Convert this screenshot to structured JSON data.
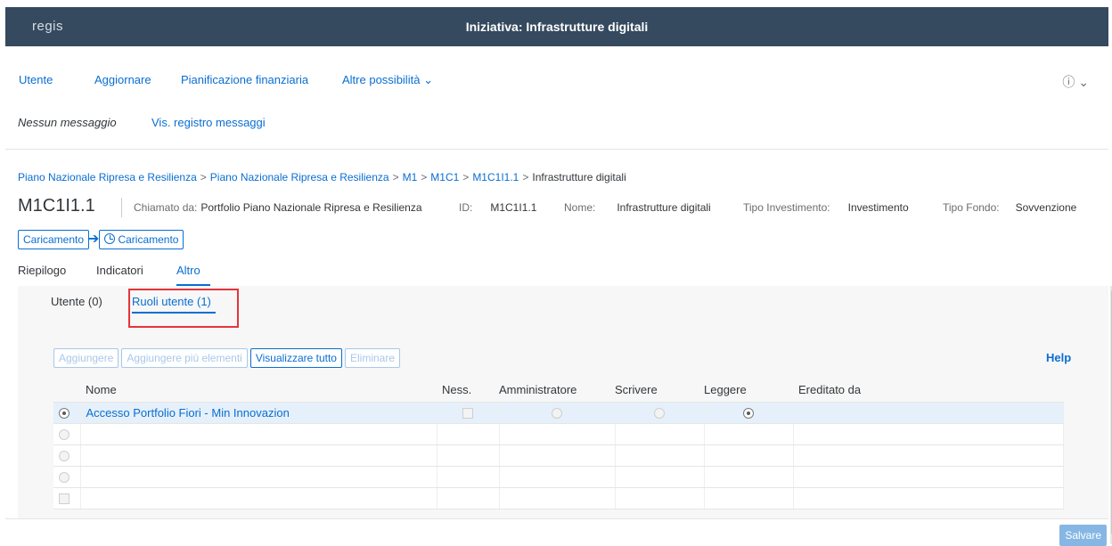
{
  "header": {
    "logo": "regis",
    "title": "Iniziativa: Infrastrutture digitali"
  },
  "menu": {
    "items": [
      "Utente",
      "Aggiornare",
      "Pianificazione finanziaria",
      "Altre possibilità"
    ],
    "more_chevron": "chevron-down-icon",
    "help_icon": "question-circle-icon"
  },
  "messages": {
    "none": "Nessun messaggio",
    "log": "Vis. registro messaggi"
  },
  "breadcrumb": {
    "links": [
      "Piano Nazionale Ripresa e Resilienza",
      "Piano Nazionale Ripresa e Resilienza",
      "M1",
      "M1C1",
      "M1C1I1.1"
    ],
    "separator": ">",
    "current": "Infrastrutture digitali"
  },
  "object": {
    "title": "M1C1I1.1",
    "attributes": [
      {
        "label": "Chiamato da:",
        "value": "Portfolio Piano Nazionale Ripresa e Resilienza"
      },
      {
        "label": "ID:",
        "value": "M1C1I1.1"
      },
      {
        "label": "Nome:",
        "value": "Infrastrutture digitali"
      },
      {
        "label": "Tipo Investimento:",
        "value": "Investimento"
      },
      {
        "label": "Tipo Fondo:",
        "value": "Sovvenzione"
      }
    ]
  },
  "flow": {
    "step1": "Caricamento",
    "step2": "Caricamento"
  },
  "tabs": [
    "Riepilogo",
    "Indicatori",
    "Altro"
  ],
  "active_tab": "Altro",
  "subtabs": [
    "Utente (0)",
    "Ruoli utente (1)"
  ],
  "active_subtab": "Ruoli utente (1)",
  "toolbar": {
    "add": "Aggiungere",
    "add_many": "Aggiungere più elementi",
    "show_all": "Visualizzare tutto",
    "delete": "Eliminare",
    "help": "Help"
  },
  "table": {
    "columns": [
      "Nome",
      "Ness.",
      "Amministratore",
      "Scrivere",
      "Leggere",
      "Ereditato da"
    ],
    "rows": [
      {
        "name": "Accesso Portfolio Fiori - Min Innovazion",
        "ness": false,
        "admin": false,
        "write": false,
        "read": true,
        "inherited": ""
      }
    ],
    "empty_rows": 4
  },
  "footer": {
    "save": "Salvare"
  },
  "colors": {
    "shell_bar": "#354a5f",
    "accent": "#0a6ed1",
    "highlight": "#e6343a",
    "selected_row": "#e5f0fa"
  }
}
